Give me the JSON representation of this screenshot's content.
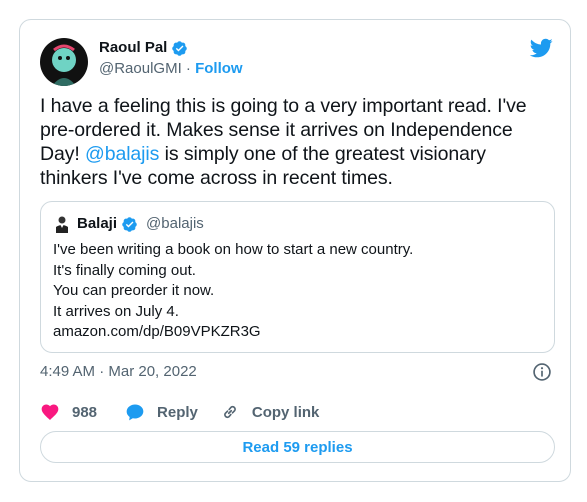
{
  "author": {
    "name": "Raoul Pal",
    "handle": "@RaoulGMI",
    "separator": "·",
    "follow_label": "Follow"
  },
  "tweet": {
    "text_before": "I have a feeling this is going to a very important read. I've pre-ordered it.  Makes sense it arrives on Independence Day! ",
    "mention": "@balajis",
    "text_after": " is simply one of the greatest visionary thinkers I've come across in recent times."
  },
  "quoted": {
    "name": "Balaji",
    "handle": "@balajis",
    "lines": [
      "I've been writing a book on how to start a new country.",
      "It's finally coming out.",
      "You can preorder it now.",
      "It arrives on July 4.",
      "amazon.com/dp/B09VPKZR3G"
    ]
  },
  "timestamp": "4:49 AM · Mar 20, 2022",
  "actions": {
    "like_count": "988",
    "reply_label": "Reply",
    "copy_link_label": "Copy link"
  },
  "read_replies_label": "Read 59 replies",
  "colors": {
    "accent": "#1d9bf0",
    "like": "#f91880",
    "border": "#cfd9de",
    "secondary_text": "#536471"
  },
  "icons": [
    "verified-badge-icon",
    "twitter-bird-icon",
    "info-icon",
    "heart-icon",
    "reply-bubble-icon",
    "link-icon"
  ]
}
